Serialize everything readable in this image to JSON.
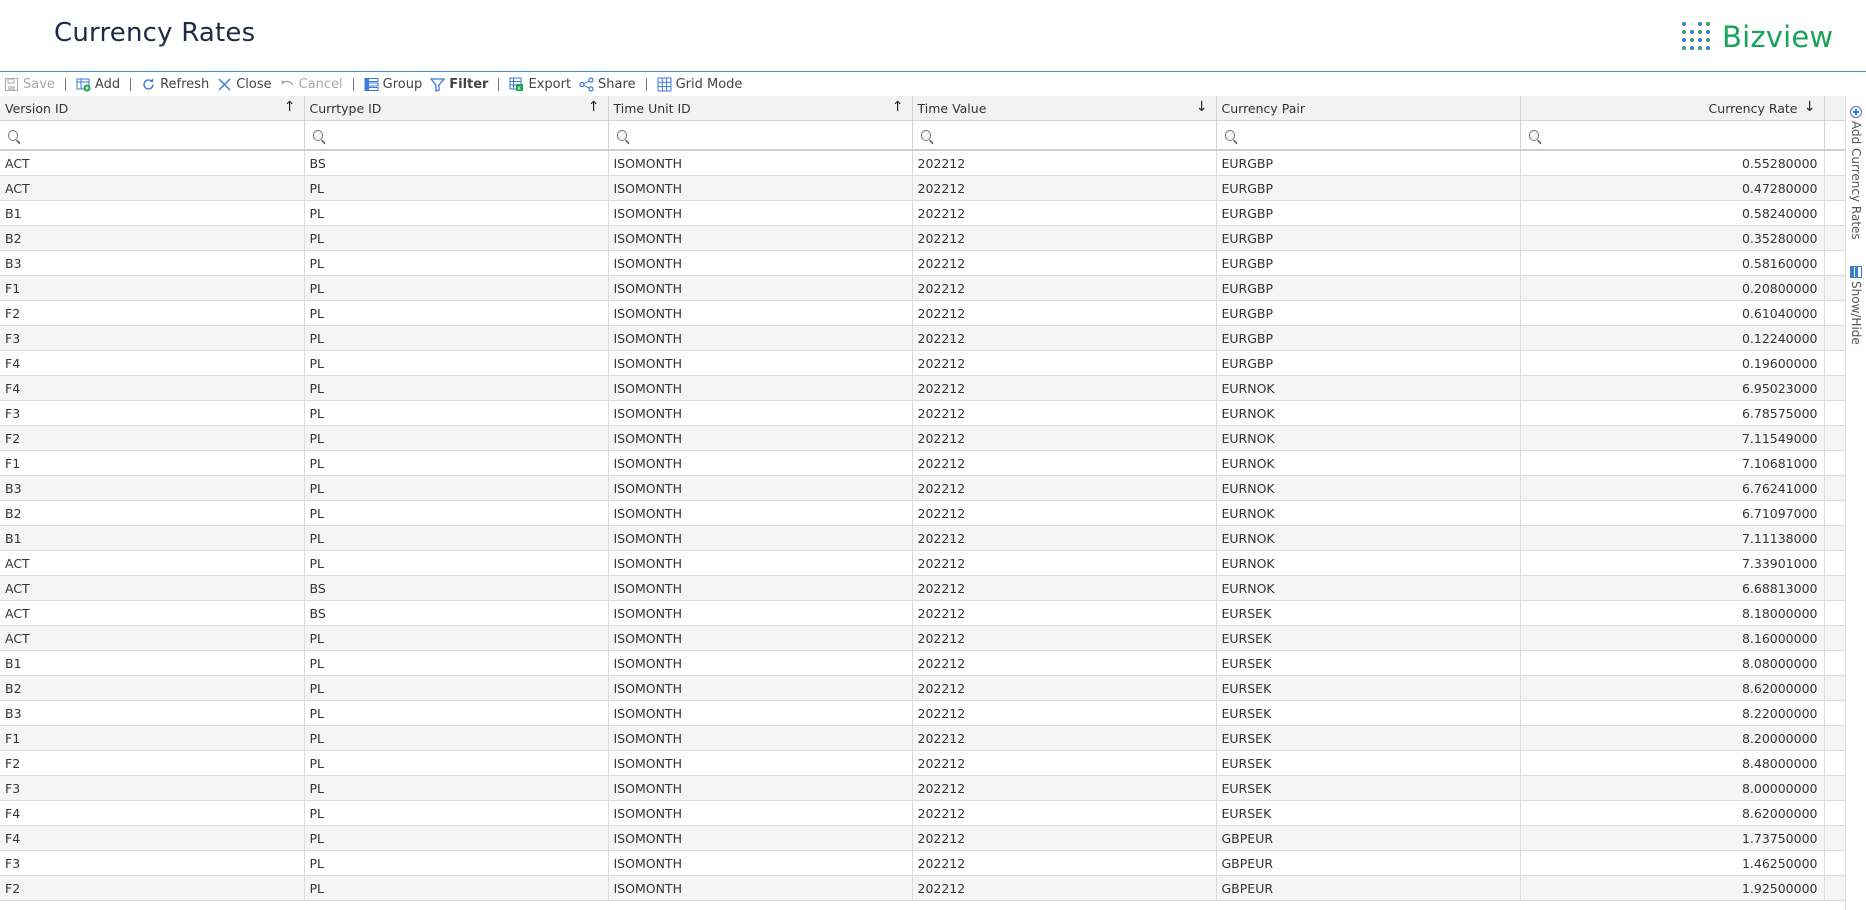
{
  "page": {
    "title": "Currency Rates"
  },
  "logo": {
    "text": "Bizview"
  },
  "toolbar": {
    "save": "Save",
    "add": "Add",
    "refresh": "Refresh",
    "close": "Close",
    "cancel": "Cancel",
    "group": "Group",
    "filter": "Filter",
    "export": "Export",
    "share": "Share",
    "grid_mode": "Grid Mode"
  },
  "grid": {
    "columns": [
      "Version ID",
      "Currtype ID",
      "Time Unit ID",
      "Time Value",
      "Currency Pair",
      "Currency Rate"
    ],
    "sort_indicators": [
      "↑",
      "↑",
      "↑",
      "↓",
      "",
      "↓"
    ],
    "rows": [
      [
        "ACT",
        "BS",
        "ISOMONTH",
        "202212",
        "EURGBP",
        "0.55280000"
      ],
      [
        "ACT",
        "PL",
        "ISOMONTH",
        "202212",
        "EURGBP",
        "0.47280000"
      ],
      [
        "B1",
        "PL",
        "ISOMONTH",
        "202212",
        "EURGBP",
        "0.58240000"
      ],
      [
        "B2",
        "PL",
        "ISOMONTH",
        "202212",
        "EURGBP",
        "0.35280000"
      ],
      [
        "B3",
        "PL",
        "ISOMONTH",
        "202212",
        "EURGBP",
        "0.58160000"
      ],
      [
        "F1",
        "PL",
        "ISOMONTH",
        "202212",
        "EURGBP",
        "0.20800000"
      ],
      [
        "F2",
        "PL",
        "ISOMONTH",
        "202212",
        "EURGBP",
        "0.61040000"
      ],
      [
        "F3",
        "PL",
        "ISOMONTH",
        "202212",
        "EURGBP",
        "0.12240000"
      ],
      [
        "F4",
        "PL",
        "ISOMONTH",
        "202212",
        "EURGBP",
        "0.19600000"
      ],
      [
        "F4",
        "PL",
        "ISOMONTH",
        "202212",
        "EURNOK",
        "6.95023000"
      ],
      [
        "F3",
        "PL",
        "ISOMONTH",
        "202212",
        "EURNOK",
        "6.78575000"
      ],
      [
        "F2",
        "PL",
        "ISOMONTH",
        "202212",
        "EURNOK",
        "7.11549000"
      ],
      [
        "F1",
        "PL",
        "ISOMONTH",
        "202212",
        "EURNOK",
        "7.10681000"
      ],
      [
        "B3",
        "PL",
        "ISOMONTH",
        "202212",
        "EURNOK",
        "6.76241000"
      ],
      [
        "B2",
        "PL",
        "ISOMONTH",
        "202212",
        "EURNOK",
        "6.71097000"
      ],
      [
        "B1",
        "PL",
        "ISOMONTH",
        "202212",
        "EURNOK",
        "7.11138000"
      ],
      [
        "ACT",
        "PL",
        "ISOMONTH",
        "202212",
        "EURNOK",
        "7.33901000"
      ],
      [
        "ACT",
        "BS",
        "ISOMONTH",
        "202212",
        "EURNOK",
        "6.68813000"
      ],
      [
        "ACT",
        "BS",
        "ISOMONTH",
        "202212",
        "EURSEK",
        "8.18000000"
      ],
      [
        "ACT",
        "PL",
        "ISOMONTH",
        "202212",
        "EURSEK",
        "8.16000000"
      ],
      [
        "B1",
        "PL",
        "ISOMONTH",
        "202212",
        "EURSEK",
        "8.08000000"
      ],
      [
        "B2",
        "PL",
        "ISOMONTH",
        "202212",
        "EURSEK",
        "8.62000000"
      ],
      [
        "B3",
        "PL",
        "ISOMONTH",
        "202212",
        "EURSEK",
        "8.22000000"
      ],
      [
        "F1",
        "PL",
        "ISOMONTH",
        "202212",
        "EURSEK",
        "8.20000000"
      ],
      [
        "F2",
        "PL",
        "ISOMONTH",
        "202212",
        "EURSEK",
        "8.48000000"
      ],
      [
        "F3",
        "PL",
        "ISOMONTH",
        "202212",
        "EURSEK",
        "8.00000000"
      ],
      [
        "F4",
        "PL",
        "ISOMONTH",
        "202212",
        "EURSEK",
        "8.62000000"
      ],
      [
        "F4",
        "PL",
        "ISOMONTH",
        "202212",
        "GBPEUR",
        "1.73750000"
      ],
      [
        "F3",
        "PL",
        "ISOMONTH",
        "202212",
        "GBPEUR",
        "1.46250000"
      ],
      [
        "F2",
        "PL",
        "ISOMONTH",
        "202212",
        "GBPEUR",
        "1.92500000"
      ]
    ]
  },
  "side_panel": {
    "add_label": "Add Currency Rates",
    "showhide_label": "Show/Hide"
  },
  "colors": {
    "accent": "#3a7bd5",
    "brand_green": "#1aa35a",
    "header_border": "#4a90d9"
  }
}
